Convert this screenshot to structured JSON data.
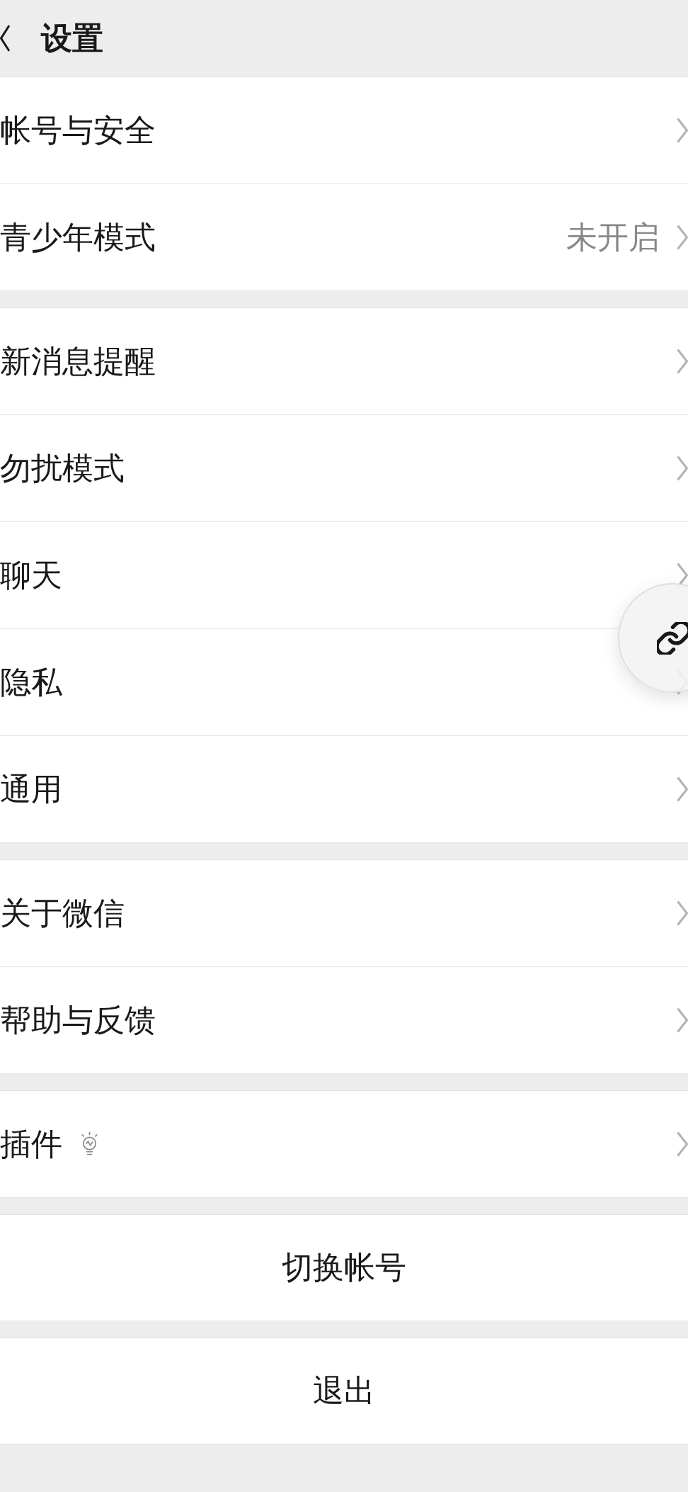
{
  "header": {
    "title": "设置"
  },
  "groups": [
    {
      "items": [
        {
          "label": "帐号与安全",
          "hint_icon": false
        },
        {
          "label": "青少年模式",
          "value": "未开启",
          "hint_icon": false
        }
      ]
    },
    {
      "items": [
        {
          "label": "新消息提醒",
          "hint_icon": false
        },
        {
          "label": "勿扰模式",
          "hint_icon": false
        },
        {
          "label": "聊天",
          "hint_icon": false
        },
        {
          "label": "隐私",
          "hint_icon": false
        },
        {
          "label": "通用",
          "hint_icon": false
        }
      ]
    },
    {
      "items": [
        {
          "label": "关于微信",
          "hint_icon": false
        },
        {
          "label": "帮助与反馈",
          "hint_icon": false
        }
      ]
    },
    {
      "items": [
        {
          "label": "插件",
          "hint_icon": true
        }
      ]
    }
  ],
  "actions": [
    {
      "label": "切换帐号"
    },
    {
      "label": "退出"
    }
  ]
}
